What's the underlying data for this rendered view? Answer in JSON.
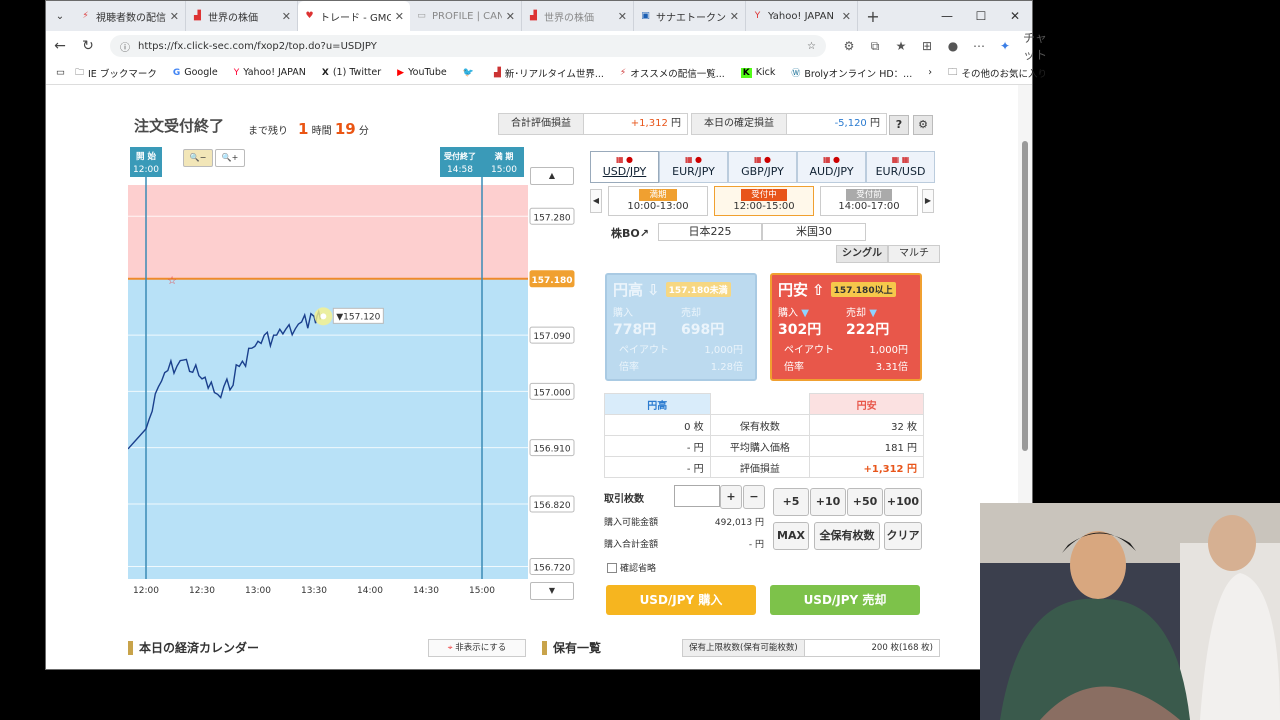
{
  "browser": {
    "tabs": [
      {
        "label": "視聴者数の配信ー",
        "state": "normal"
      },
      {
        "label": "世界の株価",
        "state": "normal"
      },
      {
        "label": "トレード - GMOクリ",
        "state": "active"
      },
      {
        "label": "PROFILE | CAND",
        "state": "dim"
      },
      {
        "label": "世界の株価",
        "state": "dim"
      },
      {
        "label": "サナエトークン協力の",
        "state": "normal"
      },
      {
        "label": "Yahoo! JAPAN",
        "state": "normal"
      }
    ],
    "url": "https://fx.click-sec.com/fxop2/top.do?u=USDJPY",
    "chat_label": "チャット",
    "bookmarks": [
      "IE ブックマーク",
      "Google",
      "Yahoo! JAPAN",
      "(1) Twitter",
      "YouTube",
      "",
      "新･リアルタイム世界...",
      "オススメの配信一覧...",
      "Kick",
      "Brolyオンライン HD：..."
    ],
    "other_favorites": "その他のお気に入り"
  },
  "header": {
    "title": "注文受付終了",
    "remain_label": "まで残り",
    "hours": "1",
    "hours_unit": "時間",
    "minutes": "19",
    "minutes_unit": "分",
    "total_label": "合計評価損益",
    "total_value": "+1,312",
    "yen": "円",
    "today_label": "本日の確定損益",
    "today_value": "-5,120",
    "help": "?",
    "settings": "⚙"
  },
  "chart_data": {
    "type": "line",
    "x": [
      "12:00",
      "12:10",
      "12:20",
      "12:30",
      "12:40",
      "12:50",
      "13:00",
      "13:10",
      "13:20",
      "13:30",
      "13:35"
    ],
    "y": [
      156.94,
      157.03,
      157.05,
      157.02,
      156.99,
      157.04,
      157.08,
      157.09,
      157.1,
      157.12,
      157.12
    ],
    "xticks": [
      "12:00",
      "12:30",
      "13:00",
      "13:30",
      "14:00",
      "14:30",
      "15:00"
    ],
    "yticks": [
      "157.280",
      "157.180",
      "157.090",
      "157.000",
      "156.910",
      "156.820",
      "156.720"
    ],
    "ylim": [
      156.7,
      157.33
    ],
    "strike": "157.180",
    "current": "157.120",
    "start_label": [
      "開 始",
      "12:00"
    ],
    "end_labels": [
      "受付終了",
      "14:58",
      "満 期",
      "15:00"
    ]
  },
  "pairs": [
    "USD/JPY",
    "EUR/JPY",
    "GBP/JPY",
    "AUD/JPY",
    "EUR/USD"
  ],
  "sessions": [
    {
      "status": "満期",
      "time": "10:00-13:00",
      "color": "#f0a030"
    },
    {
      "status": "受付中",
      "time": "12:00-15:00",
      "color": "#e8551a"
    },
    {
      "status": "受付前",
      "time": "14:00-17:00",
      "color": "#aaaaaa"
    }
  ],
  "products": {
    "bo": "株BO↗",
    "nikkei": "日本225",
    "us": "米国30",
    "single": "シングル",
    "multi": "マルチ"
  },
  "cards": {
    "high": {
      "title": "円高",
      "cond": "157.180未満",
      "buy_label": "購入",
      "buy": "778円",
      "sell_label": "売却",
      "sell": "698円",
      "payout_label": "ペイアウト",
      "payout": "1,000円",
      "rate_label": "倍率",
      "rate": "1.28倍"
    },
    "low": {
      "title": "円安",
      "cond": "157.180以上",
      "buy_label": "購入",
      "buy": "302円",
      "sell_label": "売却",
      "sell": "222円",
      "payout_label": "ペイアウト",
      "payout": "1,000円",
      "rate_label": "倍率",
      "rate": "3.31倍"
    }
  },
  "holdings": {
    "h_high": "円高",
    "h_low": "円安",
    "rows": [
      {
        "high": "0 枚",
        "label": "保有枚数",
        "low": "32 枚"
      },
      {
        "high": "- 円",
        "label": "平均購入価格",
        "low": "181 円"
      },
      {
        "high": "- 円",
        "label": "評価損益",
        "low": "+1,312 円"
      }
    ]
  },
  "order": {
    "qty_label": "取引枚数",
    "plus": "+",
    "minus": "−",
    "inc": [
      "+5",
      "+10",
      "+50",
      "+100"
    ],
    "avail_label": "購入可能金額",
    "avail": "492,013 円",
    "total_label": "購入合計金額",
    "total": "- 円",
    "max": "MAX",
    "all": "全保有枚数",
    "clear": "クリア",
    "confirm": "確認省略",
    "buy_btn": "USD/JPY 購入",
    "sell_btn": "USD/JPY 売却"
  },
  "bottom": {
    "calendar": "本日の経済カレンダー",
    "hide": "非表示にする",
    "holdings": "保有一覧",
    "limit_label": "保有上限枚数(保有可能枚数)",
    "limit": "200 枚(168 枚)"
  }
}
